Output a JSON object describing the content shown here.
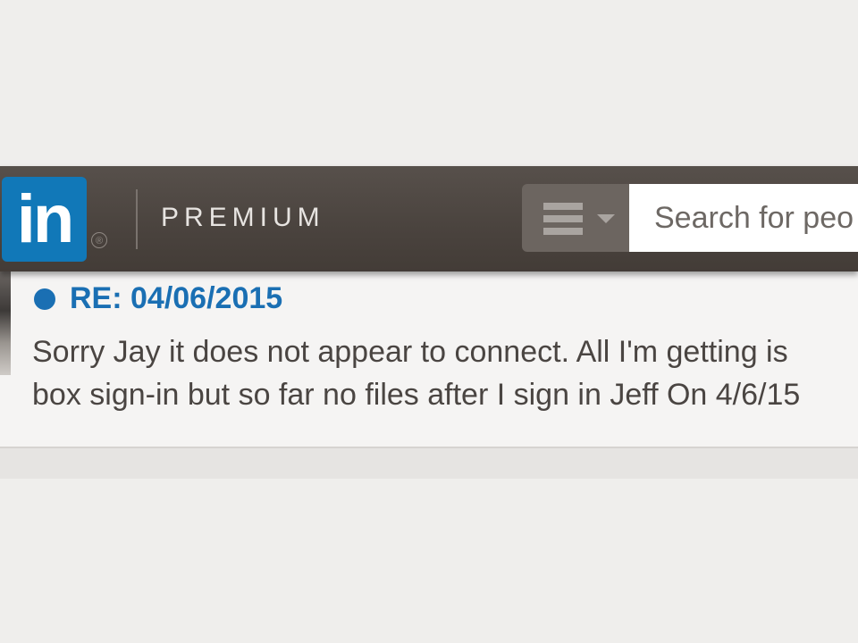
{
  "header": {
    "logo_text": "in",
    "logo_reg_mark": "®",
    "product_label": "PREMIUM",
    "menu_icon": "hamburger-menu-icon",
    "search_placeholder": "Search for peo"
  },
  "message": {
    "subject": "RE: 04/06/2015",
    "body_lines": [
      "Sorry Jay it does not appear to connect. All I'm getting is",
      "box sign-in but so far no files after I sign in Jeff On 4/6/15"
    ],
    "unread_indicator": "unread-dot-icon"
  },
  "colors": {
    "brand_blue": "#1178b8",
    "link_blue": "#1a6fb3",
    "header_bg": "#4a433e"
  }
}
